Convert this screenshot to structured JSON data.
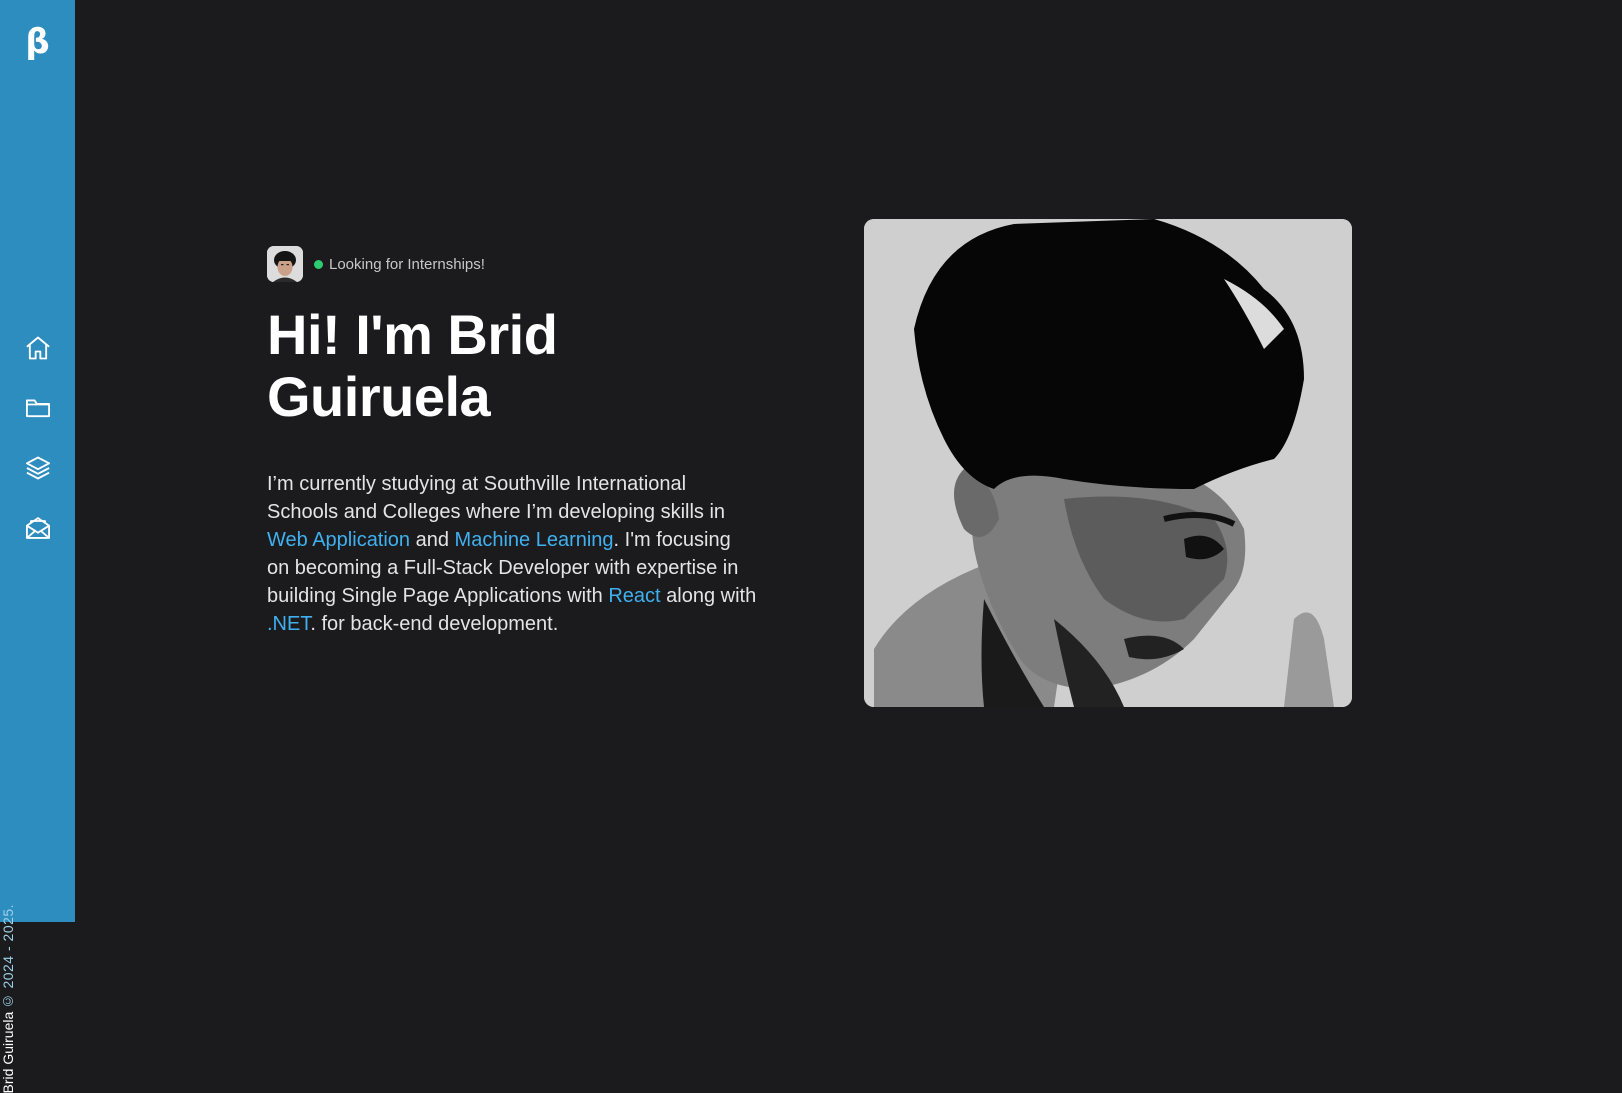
{
  "sidebar": {
    "logo": "β",
    "nav": [
      {
        "icon": "home-icon"
      },
      {
        "icon": "folder-icon"
      },
      {
        "icon": "layers-icon"
      },
      {
        "icon": "mail-open-icon"
      }
    ],
    "credit_name": "Brid Guiruela",
    "credit_year": "© 2024 - 2025."
  },
  "hero": {
    "status": "Looking for Internships!",
    "title_line1": "Hi! I'm Brid",
    "title_line2": "Guiruela",
    "bio": {
      "part1": "I’m currently studying at Southville International Schools and Colleges where I’m developing skills in ",
      "link1": "Web Application",
      "part2": " and ",
      "link2": "Machine Learning",
      "part3": ". I'm focusing on becoming a Full-Stack Developer with expertise in building Single Page Applications with ",
      "link3": "React",
      "part4": " along with ",
      "link4": ".NET",
      "part5": ". for back-end development."
    }
  },
  "colors": {
    "sidebar": "#2d8dbe",
    "background": "#1b1b1d",
    "link": "#3fb0f0",
    "status_dot": "#2ecc71"
  }
}
